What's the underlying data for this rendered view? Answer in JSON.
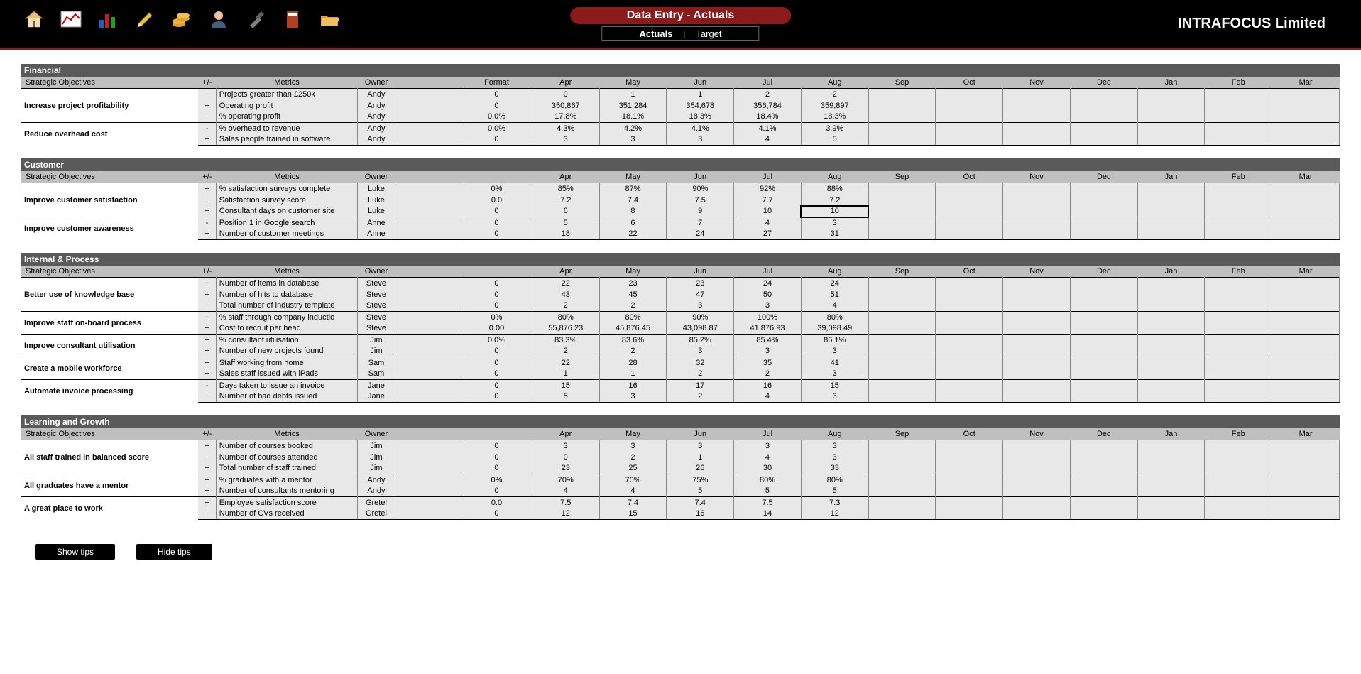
{
  "header": {
    "title": "Data Entry - Actuals",
    "tab_actuals": "Actuals",
    "tab_target": "Target",
    "company": "INTRAFOCUS Limited"
  },
  "columns": {
    "objectives": "Strategic Objectives",
    "pm": "+/-",
    "metrics": "Metrics",
    "owner": "Owner",
    "format": "Format",
    "months": [
      "Apr",
      "May",
      "Jun",
      "Jul",
      "Aug",
      "Sep",
      "Oct",
      "Nov",
      "Dec",
      "Jan",
      "Feb",
      "Mar"
    ]
  },
  "sections": [
    {
      "name": "Financial",
      "show_format": true,
      "objectives": [
        {
          "label": "Increase project profitability",
          "rows": [
            {
              "pm": "+",
              "metric": "Projects greater than £250k",
              "owner": "Andy",
              "format": "0",
              "vals": [
                "0",
                "1",
                "1",
                "2",
                "2",
                "",
                "",
                "",
                "",
                "",
                "",
                ""
              ]
            },
            {
              "pm": "+",
              "metric": "Operating profit",
              "owner": "Andy",
              "format": "0",
              "vals": [
                "350,867",
                "351,284",
                "354,678",
                "356,784",
                "359,897",
                "",
                "",
                "",
                "",
                "",
                "",
                ""
              ]
            },
            {
              "pm": "+",
              "metric": "% operating profit",
              "owner": "Andy",
              "format": "0.0%",
              "vals": [
                "17.8%",
                "18.1%",
                "18.3%",
                "18.4%",
                "18.3%",
                "",
                "",
                "",
                "",
                "",
                "",
                ""
              ]
            }
          ]
        },
        {
          "label": "Reduce overhead cost",
          "rows": [
            {
              "pm": "-",
              "metric": "% overhead to revenue",
              "owner": "Andy",
              "format": "0.0%",
              "vals": [
                "4.3%",
                "4.2%",
                "4.1%",
                "4.1%",
                "3.9%",
                "",
                "",
                "",
                "",
                "",
                "",
                ""
              ]
            },
            {
              "pm": "+",
              "metric": "Sales people trained in software",
              "owner": "Andy",
              "format": "0",
              "vals": [
                "3",
                "3",
                "3",
                "4",
                "5",
                "",
                "",
                "",
                "",
                "",
                "",
                ""
              ]
            }
          ]
        }
      ]
    },
    {
      "name": "Customer",
      "show_format": false,
      "objectives": [
        {
          "label": "Improve customer satisfaction",
          "rows": [
            {
              "pm": "+",
              "metric": "% satisfaction surveys complete",
              "owner": "Luke",
              "format": "0%",
              "vals": [
                "85%",
                "87%",
                "90%",
                "92%",
                "88%",
                "",
                "",
                "",
                "",
                "",
                "",
                ""
              ]
            },
            {
              "pm": "+",
              "metric": "Satisfaction survey score",
              "owner": "Luke",
              "format": "0.0",
              "vals": [
                "7.2",
                "7.4",
                "7.5",
                "7.7",
                "7.2",
                "",
                "",
                "",
                "",
                "",
                "",
                ""
              ]
            },
            {
              "pm": "+",
              "metric": "Consultant days on customer site",
              "owner": "Luke",
              "format": "0",
              "vals": [
                "6",
                "8",
                "9",
                "10",
                "10",
                "",
                "",
                "",
                "",
                "",
                "",
                ""
              ],
              "selected": 4
            }
          ]
        },
        {
          "label": "Improve customer awareness",
          "rows": [
            {
              "pm": "-",
              "metric": "Position 1 in Google search",
              "owner": "Anne",
              "format": "0",
              "vals": [
                "5",
                "6",
                "7",
                "4",
                "3",
                "",
                "",
                "",
                "",
                "",
                "",
                ""
              ]
            },
            {
              "pm": "+",
              "metric": "Number of customer meetings",
              "owner": "Anne",
              "format": "0",
              "vals": [
                "18",
                "22",
                "24",
                "27",
                "31",
                "",
                "",
                "",
                "",
                "",
                "",
                ""
              ]
            }
          ]
        }
      ]
    },
    {
      "name": "Internal & Process",
      "show_format": false,
      "objectives": [
        {
          "label": "Better use of knowledge base",
          "rows": [
            {
              "pm": "+",
              "metric": "Number of items in database",
              "owner": "Steve",
              "format": "0",
              "vals": [
                "22",
                "23",
                "23",
                "24",
                "24",
                "",
                "",
                "",
                "",
                "",
                "",
                ""
              ]
            },
            {
              "pm": "+",
              "metric": "Number of hits to database",
              "owner": "Steve",
              "format": "0",
              "vals": [
                "43",
                "45",
                "47",
                "50",
                "51",
                "",
                "",
                "",
                "",
                "",
                "",
                ""
              ]
            },
            {
              "pm": "+",
              "metric": "Total number of industry template",
              "owner": "Steve",
              "format": "0",
              "vals": [
                "2",
                "2",
                "3",
                "3",
                "4",
                "",
                "",
                "",
                "",
                "",
                "",
                ""
              ]
            }
          ]
        },
        {
          "label": "Improve staff on-board process",
          "rows": [
            {
              "pm": "+",
              "metric": "% staff through company inductio",
              "owner": "Steve",
              "format": "0%",
              "vals": [
                "80%",
                "80%",
                "90%",
                "100%",
                "80%",
                "",
                "",
                "",
                "",
                "",
                "",
                ""
              ]
            },
            {
              "pm": "+",
              "metric": "Cost to recruit per head",
              "owner": "Steve",
              "format": "0.00",
              "vals": [
                "55,876.23",
                "45,876.45",
                "43,098.87",
                "41,876.93",
                "39,098.49",
                "",
                "",
                "",
                "",
                "",
                "",
                ""
              ]
            }
          ]
        },
        {
          "label": "Improve consultant utilisation",
          "rows": [
            {
              "pm": "+",
              "metric": "% consultant utilisation",
              "owner": "Jim",
              "format": "0.0%",
              "vals": [
                "83.3%",
                "83.6%",
                "85.2%",
                "85.4%",
                "86.1%",
                "",
                "",
                "",
                "",
                "",
                "",
                ""
              ]
            },
            {
              "pm": "+",
              "metric": "Number of new projects found",
              "owner": "Jim",
              "format": "0",
              "vals": [
                "2",
                "2",
                "3",
                "3",
                "3",
                "",
                "",
                "",
                "",
                "",
                "",
                ""
              ]
            }
          ]
        },
        {
          "label": "Create a mobile workforce",
          "rows": [
            {
              "pm": "+",
              "metric": "Staff working from home",
              "owner": "Sam",
              "format": "0",
              "vals": [
                "22",
                "28",
                "32",
                "35",
                "41",
                "",
                "",
                "",
                "",
                "",
                "",
                ""
              ]
            },
            {
              "pm": "+",
              "metric": "Sales staff issued with iPads",
              "owner": "Sam",
              "format": "0",
              "vals": [
                "1",
                "1",
                "2",
                "2",
                "3",
                "",
                "",
                "",
                "",
                "",
                "",
                ""
              ]
            }
          ]
        },
        {
          "label": "Automate invoice processing",
          "rows": [
            {
              "pm": "-",
              "metric": "Days taken to issue an invoice",
              "owner": "Jane",
              "format": "0",
              "vals": [
                "15",
                "16",
                "17",
                "16",
                "15",
                "",
                "",
                "",
                "",
                "",
                "",
                ""
              ]
            },
            {
              "pm": "+",
              "metric": "Number of bad debts issued",
              "owner": "Jane",
              "format": "0",
              "vals": [
                "5",
                "3",
                "2",
                "4",
                "3",
                "",
                "",
                "",
                "",
                "",
                "",
                ""
              ]
            }
          ]
        }
      ]
    },
    {
      "name": "Learning and Growth",
      "show_format": false,
      "objectives": [
        {
          "label": "All staff trained in balanced score",
          "rows": [
            {
              "pm": "+",
              "metric": "Number of courses booked",
              "owner": "Jim",
              "format": "0",
              "vals": [
                "3",
                "3",
                "3",
                "3",
                "3",
                "",
                "",
                "",
                "",
                "",
                "",
                ""
              ]
            },
            {
              "pm": "+",
              "metric": "Number of courses attended",
              "owner": "Jim",
              "format": "0",
              "vals": [
                "0",
                "2",
                "1",
                "4",
                "3",
                "",
                "",
                "",
                "",
                "",
                "",
                ""
              ]
            },
            {
              "pm": "+",
              "metric": "Total number of staff trained",
              "owner": "Jim",
              "format": "0",
              "vals": [
                "23",
                "25",
                "26",
                "30",
                "33",
                "",
                "",
                "",
                "",
                "",
                "",
                ""
              ]
            }
          ]
        },
        {
          "label": "All graduates have a mentor",
          "rows": [
            {
              "pm": "+",
              "metric": "% graduates with a mentor",
              "owner": "Andy",
              "format": "0%",
              "vals": [
                "70%",
                "70%",
                "75%",
                "80%",
                "80%",
                "",
                "",
                "",
                "",
                "",
                "",
                ""
              ]
            },
            {
              "pm": "+",
              "metric": "Number of consultants mentoring",
              "owner": "Andy",
              "format": "0",
              "vals": [
                "4",
                "4",
                "5",
                "5",
                "5",
                "",
                "",
                "",
                "",
                "",
                "",
                ""
              ]
            }
          ]
        },
        {
          "label": "A great place to work",
          "rows": [
            {
              "pm": "+",
              "metric": "Employee satisfaction score",
              "owner": "Gretel",
              "format": "0.0",
              "vals": [
                "7.5",
                "7.4",
                "7.4",
                "7.5",
                "7.3",
                "",
                "",
                "",
                "",
                "",
                "",
                ""
              ]
            },
            {
              "pm": "+",
              "metric": "Number of CVs received",
              "owner": "Gretel",
              "format": "0",
              "vals": [
                "12",
                "15",
                "16",
                "14",
                "12",
                "",
                "",
                "",
                "",
                "",
                "",
                ""
              ]
            }
          ]
        }
      ]
    }
  ],
  "footer": {
    "show_tips": "Show tips",
    "hide_tips": "Hide tips"
  }
}
